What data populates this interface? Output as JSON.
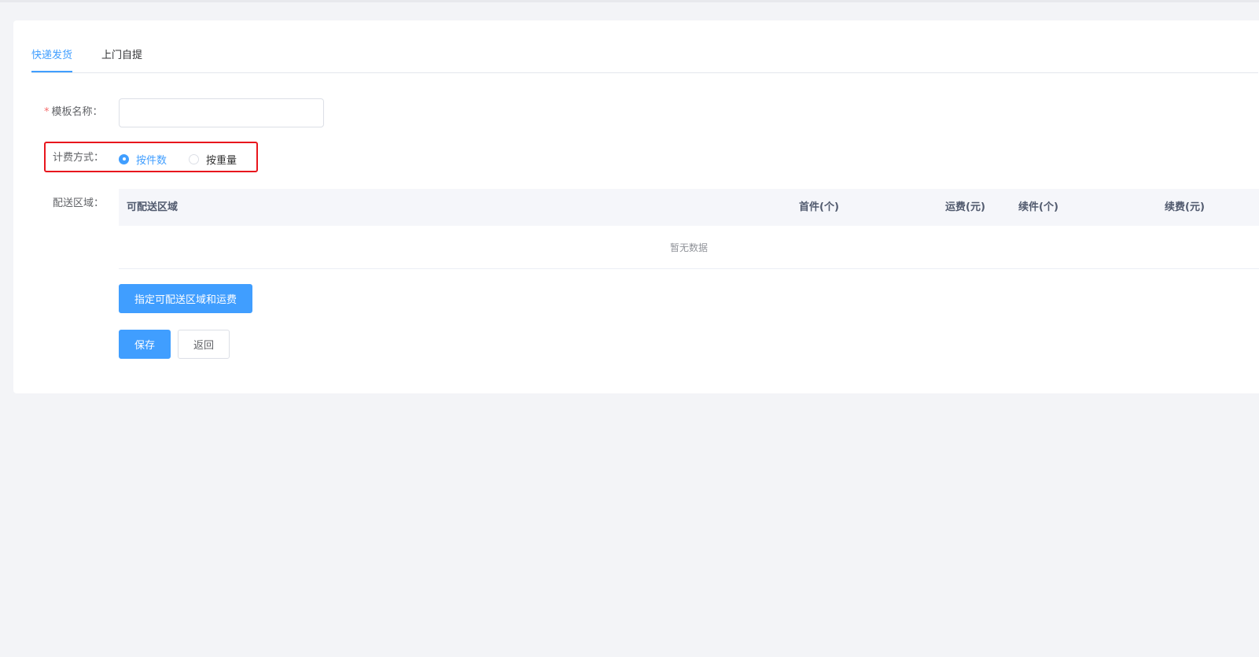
{
  "tabs": [
    {
      "label": "快递发货",
      "active": true
    },
    {
      "label": "上门自提",
      "active": false
    }
  ],
  "form": {
    "template_name": {
      "required_mark": "*",
      "label": "模板名称：",
      "value": "",
      "placeholder": ""
    },
    "billing": {
      "label": "计费方式：",
      "options": [
        {
          "label": "按件数",
          "checked": true
        },
        {
          "label": "按重量",
          "checked": false
        }
      ]
    },
    "delivery_area": {
      "label": "配送区域：",
      "columns": [
        "可配送区域",
        "首件(个)",
        "运费(元)",
        "续件(个)",
        "续费(元)"
      ],
      "rows": [],
      "empty_text": "暂无数据",
      "add_button": "指定可配送区域和运费"
    }
  },
  "actions": {
    "save": "保存",
    "back": "返回"
  },
  "colors": {
    "primary": "#409eff",
    "highlight": "#e8161d",
    "required": "#f56c6c",
    "background": "#f3f4f7"
  }
}
